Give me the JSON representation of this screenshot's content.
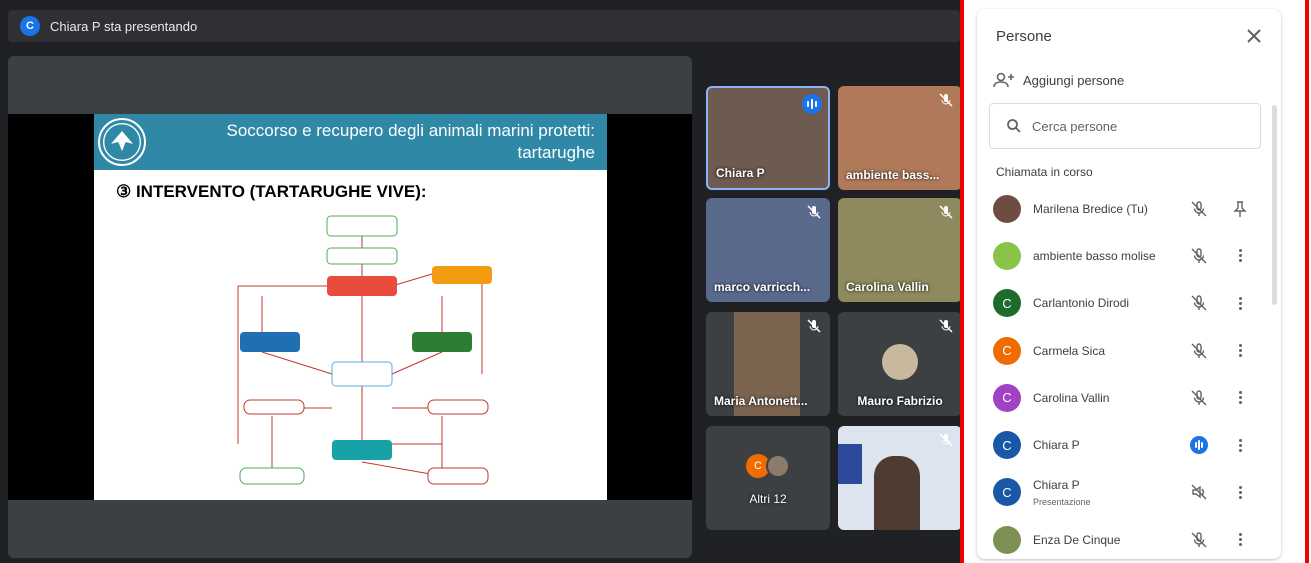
{
  "presenting_bar": {
    "avatar_letter": "C",
    "text": "Chiara P sta presentando"
  },
  "slide": {
    "title_line1": "Soccorso e recupero degli animali marini protetti:",
    "title_line2": "tartarughe",
    "heading": "③ INTERVENTO (TARTARUGHE VIVE):"
  },
  "tiles": [
    {
      "name": "Chiara P",
      "state": "speaking"
    },
    {
      "name": "ambiente bass...",
      "state": "muted"
    },
    {
      "name": "marco varricch...",
      "state": "muted"
    },
    {
      "name": "Carolina Vallin",
      "state": "muted"
    },
    {
      "name": "Maria Antonett...",
      "state": "muted"
    },
    {
      "name": "Mauro Fabrizio",
      "state": "muted"
    },
    {
      "name": "Altri 12",
      "state": "others",
      "avatar_letter": "C"
    },
    {
      "name": "",
      "state": "muted"
    }
  ],
  "panel": {
    "title": "Persone",
    "add_people": "Aggiungi persone",
    "search_placeholder": "Cerca persone",
    "section_label": "Chiamata in corso",
    "people": [
      {
        "name": "Marilena Bredice (Tu)",
        "avatar_letter": "",
        "avatar_color": "#6d4c41",
        "icon": "mic-off-icon",
        "action": "pin-icon"
      },
      {
        "name": "ambiente basso molise",
        "avatar_letter": "",
        "avatar_color": "#8bc34a",
        "icon": "mic-off-icon",
        "action": "more-icon"
      },
      {
        "name": "Carlantonio Dirodi",
        "avatar_letter": "C",
        "avatar_color": "#1e6b2e",
        "icon": "mic-off-icon",
        "action": "more-icon"
      },
      {
        "name": "Carmela Sica",
        "avatar_letter": "C",
        "avatar_color": "#ef6c00",
        "icon": "mic-off-icon",
        "action": "more-icon"
      },
      {
        "name": "Carolina Vallin",
        "avatar_letter": "C",
        "avatar_color": "#a142c4",
        "icon": "mic-off-icon",
        "action": "more-icon"
      },
      {
        "name": "Chiara P",
        "avatar_letter": "C",
        "avatar_color": "#1958a6",
        "icon": "speaking-icon",
        "action": "more-icon"
      },
      {
        "name": "Chiara P",
        "subtitle": "Presentazione",
        "avatar_letter": "C",
        "avatar_color": "#1958a6",
        "icon": "presentation-audio-off-icon",
        "action": "more-icon"
      },
      {
        "name": "Enza De Cinque",
        "avatar_letter": "",
        "avatar_color": "#7d8f52",
        "icon": "mic-off-icon",
        "action": "more-icon"
      }
    ]
  }
}
